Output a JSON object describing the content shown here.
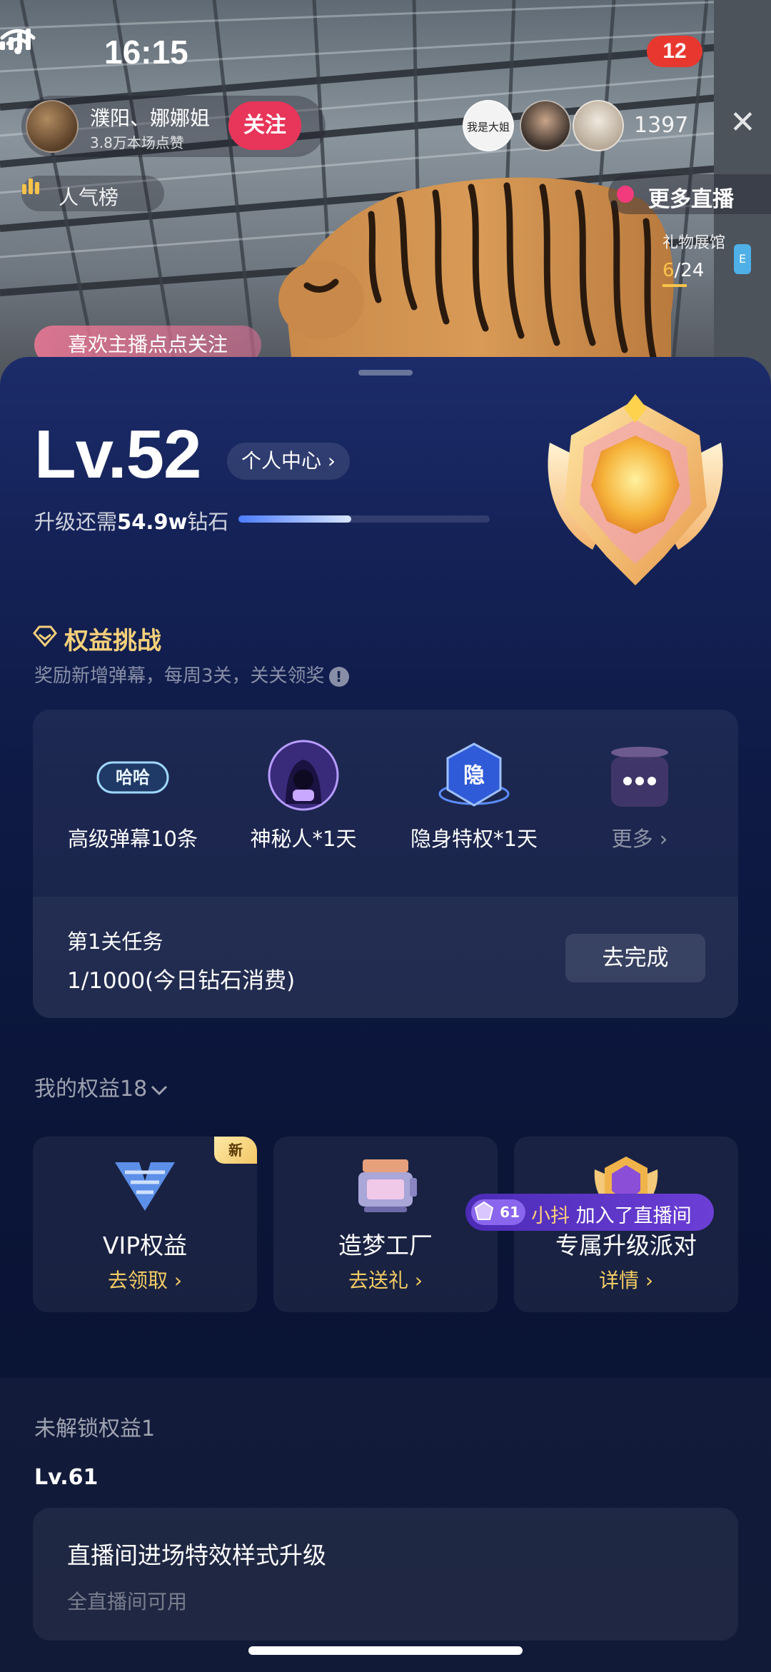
{
  "status": {
    "time": "16:15",
    "battery": "12"
  },
  "host": {
    "name": "濮阳、娜娜姐",
    "subtitle": "3.8万本场点赞",
    "follow_label": "关注"
  },
  "viewers": {
    "first_avatar_text": "我是大姐",
    "count": "1397"
  },
  "popularity_label": "人气榜",
  "more_live_label": "更多直播",
  "gift_hall": {
    "label": "礼物展馆",
    "current": "6",
    "total": "/24",
    "badge": "E"
  },
  "like_hint": "喜欢主播点点关注",
  "level": {
    "title": "Lv.52",
    "personal_center": "个人中心 ›",
    "upgrade_prefix": "升级还需",
    "upgrade_amount": "54.9w",
    "upgrade_suffix": "钻石",
    "progress": 0.45
  },
  "challenge": {
    "title": "权益挑战",
    "subtitle": "奖励新增弹幕，每周3关，关关领奖",
    "rewards": [
      {
        "label": "高级弹幕10条",
        "tag": "哈哈",
        "icon": "danmaku-icon"
      },
      {
        "label": "神秘人*1天",
        "icon": "mystery-person-icon"
      },
      {
        "label": "隐身特权*1天",
        "tag": "隐",
        "icon": "invisible-icon"
      },
      {
        "label": "更多 ›",
        "icon": "more-rewards-icon"
      }
    ],
    "task_title": "第1关任务",
    "task_progress": "1/1000(今日钻石消费)",
    "task_button": "去完成"
  },
  "my_rights": {
    "title": "我的权益18",
    "items": [
      {
        "name": "VIP权益",
        "action": "去领取 ›",
        "badge": "新",
        "icon": "vip-icon"
      },
      {
        "name": "造梦工厂",
        "action": "去送礼 ›",
        "icon": "dream-factory-icon"
      },
      {
        "name": "专属升级派对",
        "action": "详情 ›",
        "icon": "upgrade-party-icon"
      }
    ]
  },
  "locked_rights": {
    "title": "未解锁权益1",
    "level": "Lv.61",
    "item_name": "直播间进场特效样式升级",
    "item_sub": "全直播间可用"
  },
  "join_toast": {
    "level": "61",
    "user": "小抖",
    "text": " 加入了直播间"
  },
  "colors": {
    "accent_gold": "#f5d07a",
    "follow_pink": "#e8355a",
    "sheet_bg": "#0e1a45",
    "toast_purple": "#5a35c6"
  }
}
